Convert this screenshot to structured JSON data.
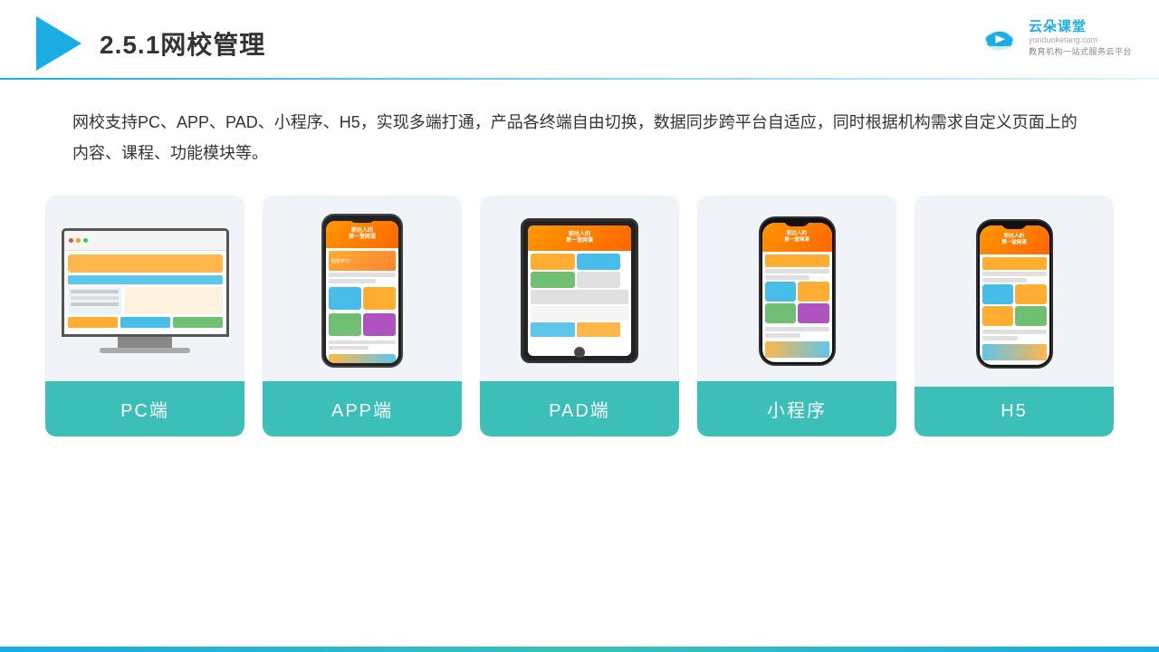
{
  "header": {
    "title": "2.5.1网校管理",
    "divider_color": "#1AACE3"
  },
  "brand": {
    "name": "云朵课堂",
    "url": "yunduoketang.com",
    "subtitle": "教育机构一站\n式服务云平台"
  },
  "description": {
    "text": "网校支持PC、APP、PAD、小程序、H5，实现多端打通，产品各终端自由切换，数据同步跨平台自适应，同时根据机构需求自定义页面上的内容、课程、功能模块等。"
  },
  "cards": [
    {
      "id": "pc",
      "label": "PC端"
    },
    {
      "id": "app",
      "label": "APP端"
    },
    {
      "id": "pad",
      "label": "PAD端"
    },
    {
      "id": "miniprogram",
      "label": "小程序"
    },
    {
      "id": "h5",
      "label": "H5"
    }
  ],
  "accent_color": "#3BBFB8",
  "logo_triangle_color": "#1AACE3"
}
